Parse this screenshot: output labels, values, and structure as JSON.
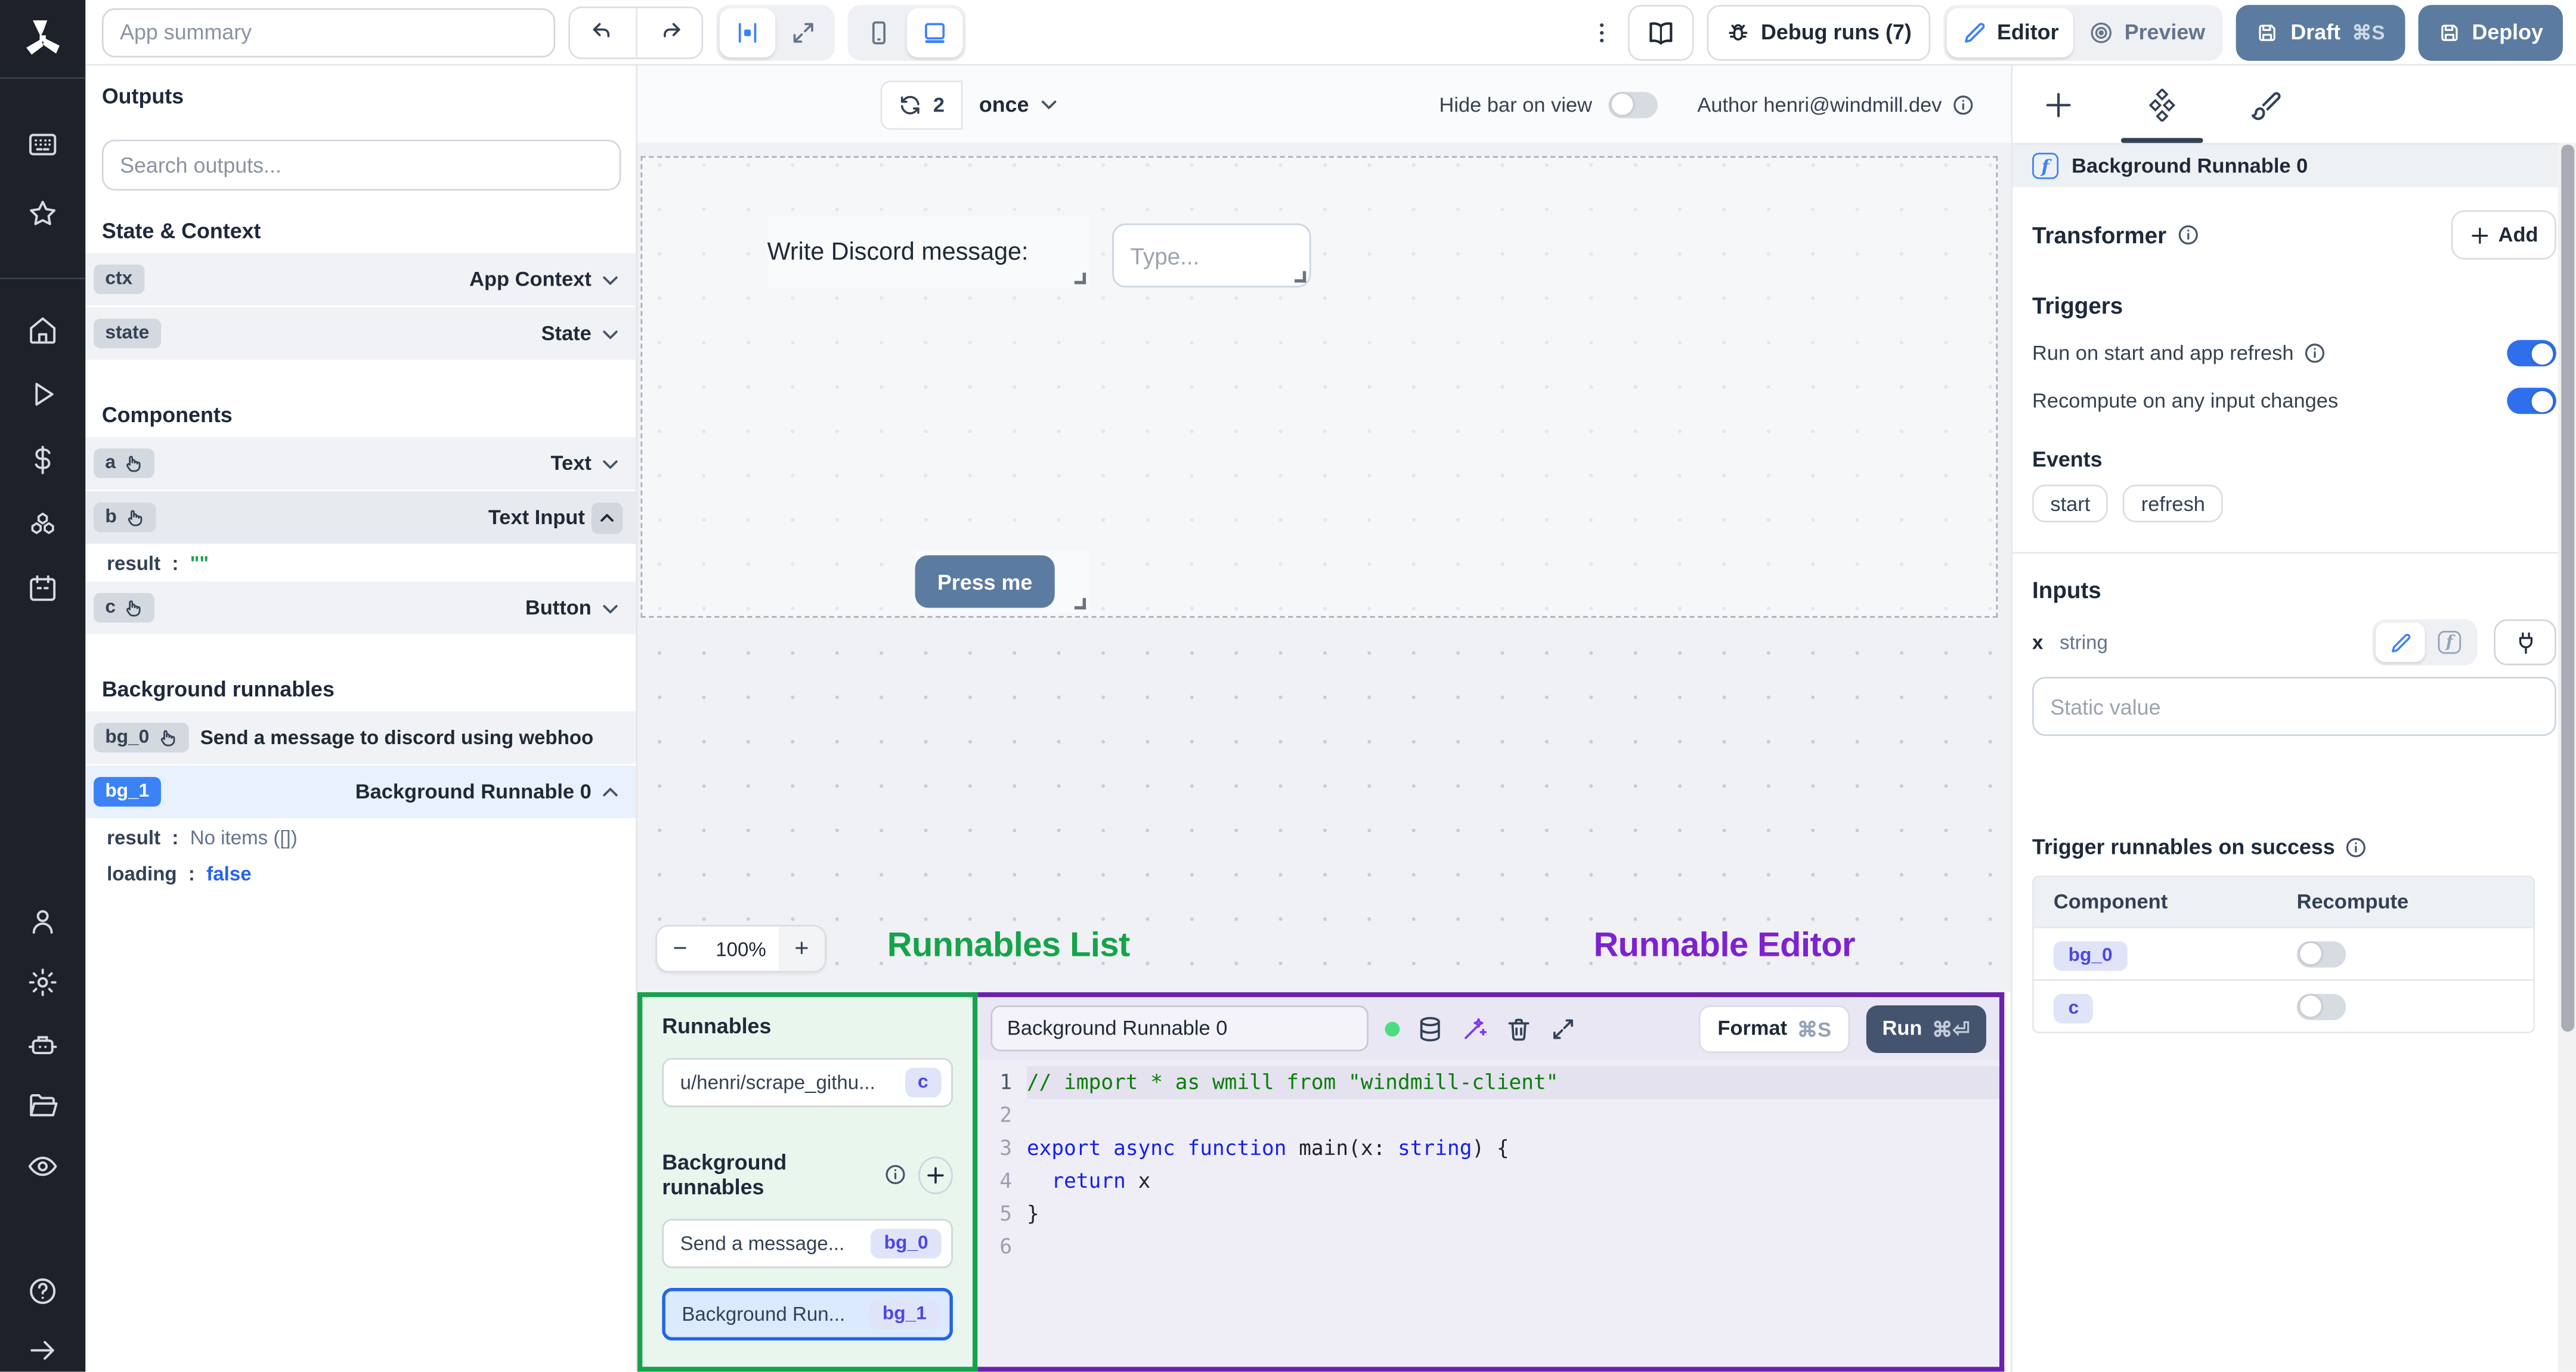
{
  "topbar": {
    "app_summary_placeholder": "App summary",
    "debug_runs_label": "Debug runs (7)",
    "editor_label": "Editor",
    "preview_label": "Preview",
    "draft_label": "Draft",
    "draft_shortcut": "⌘S",
    "deploy_label": "Deploy"
  },
  "sidebar": {
    "icons": [
      "windmill-logo",
      "apps",
      "favorites-star",
      "home",
      "runs-play",
      "variables-dollar",
      "resources-cubes",
      "schedules-calendar",
      "user",
      "settings-gear",
      "workers-robot",
      "folders",
      "audit-eye",
      "help",
      "expand-arrow"
    ]
  },
  "canvas_toolbar": {
    "refresh_count": "2",
    "interval": "once",
    "hide_bar_label": "Hide bar on view",
    "author": "Author henri@windmill.dev"
  },
  "outputs": {
    "title": "Outputs",
    "search_placeholder": "Search outputs...",
    "section_state_context": "State & Context",
    "section_components": "Components",
    "section_background": "Background runnables",
    "ctx": {
      "id": "ctx",
      "type": "App Context"
    },
    "state": {
      "id": "state",
      "type": "State"
    },
    "a": {
      "id": "a",
      "type": "Text"
    },
    "b": {
      "id": "b",
      "type": "Text Input"
    },
    "b_result": {
      "key": "result",
      "value": "\"\""
    },
    "c": {
      "id": "c",
      "type": "Button"
    },
    "bg0": {
      "id": "bg_0",
      "label": "Send a message to discord using webhoo"
    },
    "bg1": {
      "id": "bg_1",
      "label": "Background Runnable 0"
    },
    "bg1_result": {
      "key": "result",
      "value": "No items ([])"
    },
    "bg1_loading": {
      "key": "loading",
      "value": "false"
    }
  },
  "canvas": {
    "text_component": "Write Discord message:",
    "input_placeholder": "Type...",
    "button_label": "Press me",
    "zoom_out": "−",
    "zoom_level": "100%",
    "zoom_in": "+",
    "annotation_runnables": "Runnables List",
    "annotation_editor": "Runnable Editor"
  },
  "runnables_panel": {
    "title": "Runnables",
    "item_script": {
      "label": "u/henri/scrape_githu...",
      "badge": "c"
    },
    "background_header": "Background runnables",
    "item_bg0": {
      "label": "Send a message...",
      "badge": "bg_0"
    },
    "item_bg1": {
      "label": "Background Run...",
      "badge": "bg_1"
    }
  },
  "editor": {
    "title_value": "Background Runnable 0",
    "format_label": "Format",
    "format_shortcut": "⌘S",
    "run_label": "Run",
    "run_shortcut": "⌘⏎",
    "code_lines": [
      [
        {
          "t": "// import * as wmill from \"windmill-client\"",
          "c": "tok-comment"
        }
      ],
      [],
      [
        {
          "t": "export",
          "c": "tok-kw"
        },
        {
          "t": " ",
          "c": ""
        },
        {
          "t": "async",
          "c": "tok-kw"
        },
        {
          "t": " ",
          "c": ""
        },
        {
          "t": "function",
          "c": "tok-kw"
        },
        {
          "t": " main(x: ",
          "c": ""
        },
        {
          "t": "string",
          "c": "tok-type"
        },
        {
          "t": ") {",
          "c": ""
        }
      ],
      [
        {
          "t": "  ",
          "c": ""
        },
        {
          "t": "return",
          "c": "tok-kw"
        },
        {
          "t": " x",
          "c": ""
        }
      ],
      [
        {
          "t": "}",
          "c": ""
        }
      ],
      []
    ]
  },
  "right_panel": {
    "header_title": "Background Runnable 0",
    "transformer_label": "Transformer",
    "add_label": "Add",
    "triggers_label": "Triggers",
    "run_on_start": "Run on start and app refresh",
    "recompute_on_change": "Recompute on any input changes",
    "events_label": "Events",
    "event_start": "start",
    "event_refresh": "refresh",
    "inputs_label": "Inputs",
    "field_name": "x",
    "field_type": "string",
    "static_placeholder": "Static value",
    "success_title": "Trigger runnables on success",
    "table": {
      "col_component": "Component",
      "col_recompute": "Recompute",
      "rows": [
        {
          "component": "bg_0"
        },
        {
          "component": "c"
        }
      ]
    }
  },
  "colors": {
    "accent_blue": "#3b82f6",
    "toggle_on": "#2f6fed",
    "button_slate": "#5c7ba0",
    "run_button": "#44536e",
    "annotation_green": "#16a34a",
    "annotation_purple": "#7e22ce",
    "selected_badge_blue": "#3b82f6",
    "string_green": "#16a34a",
    "bool_blue": "#2563eb"
  }
}
